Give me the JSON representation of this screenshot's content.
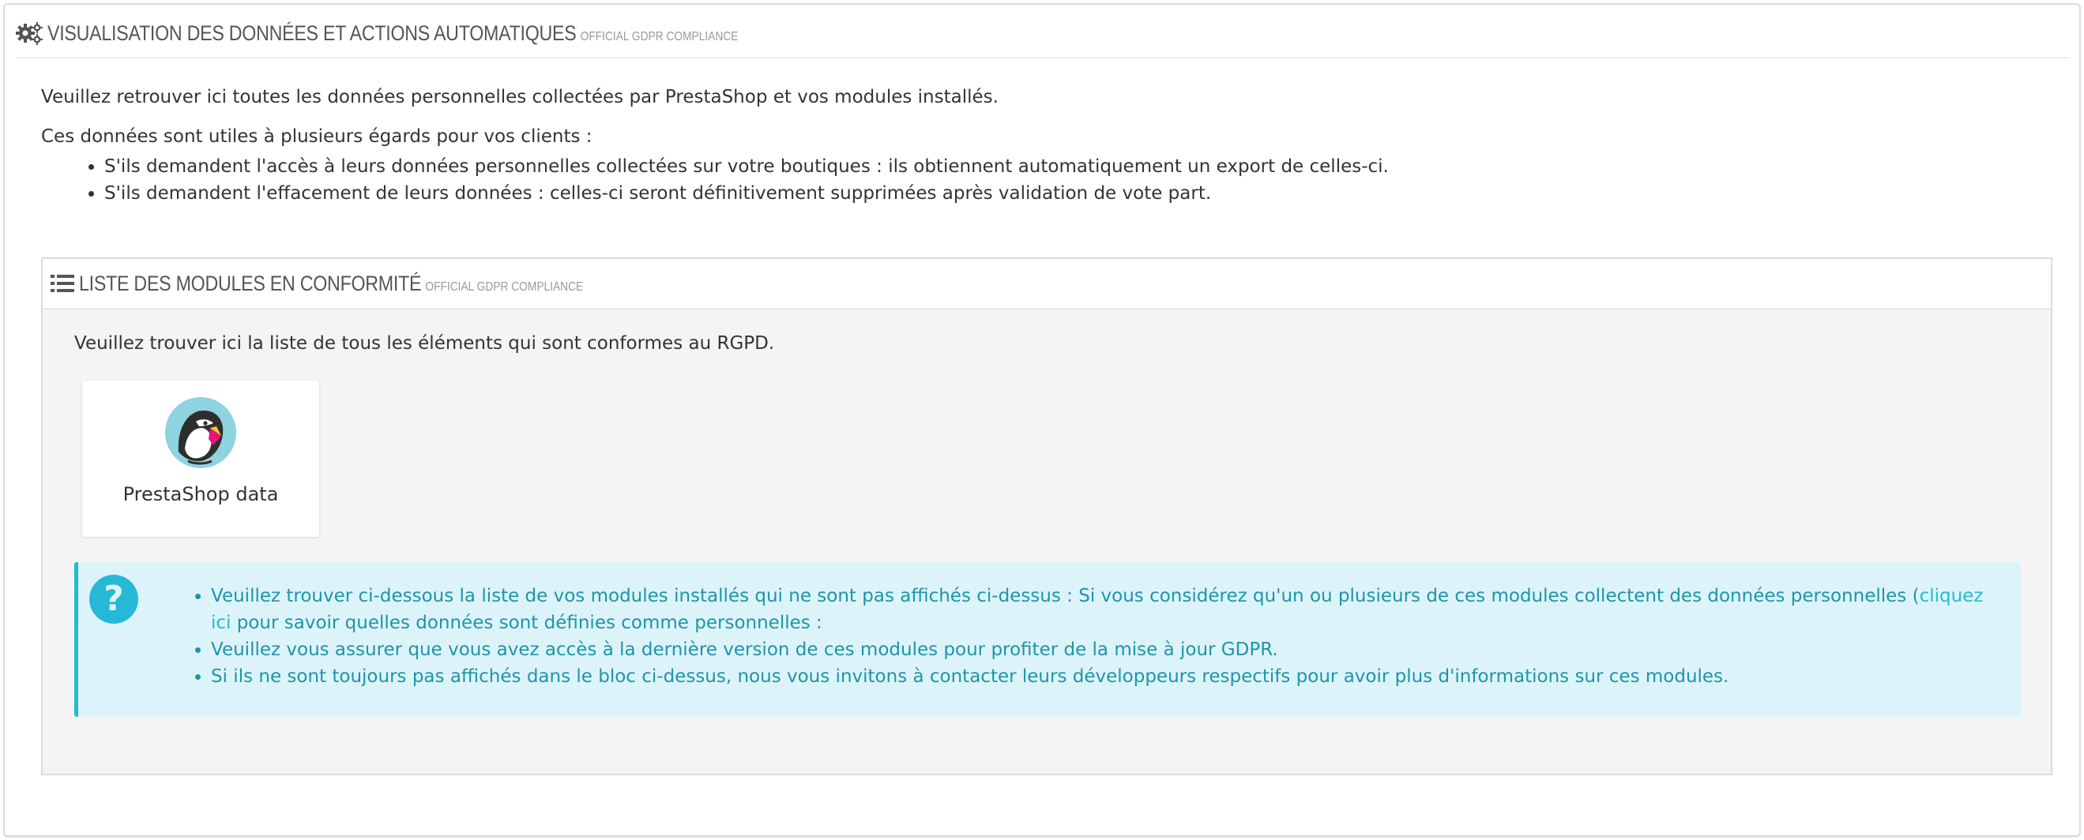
{
  "main_panel": {
    "icon": "gears-icon",
    "title": "VISUALISATION DES DONNÉES ET ACTIONS AUTOMATIQUES",
    "subtitle": "OFFICIAL GDPR COMPLIANCE",
    "intro": "Veuillez retrouver ici toutes les données personnelles collectées par PrestaShop et vos modules installés.",
    "uses_heading": "Ces données sont utiles à plusieurs égards pour vos clients :",
    "uses": [
      "S'ils demandent l'accès à leurs données personnelles collectées sur votre boutiques : ils obtiennent automatiquement un export de celles-ci.",
      "S'ils demandent l'effacement de leurs données : celles-ci seront définitivement supprimées après validation de vote part."
    ]
  },
  "modules_panel": {
    "icon": "list-icon",
    "title": "LISTE DES MODULES EN CONFORMITÉ",
    "subtitle": "OFFICIAL GDPR COMPLIANCE",
    "description": "Veuillez trouver ici la liste de tous les éléments qui sont conformes au RGPD.",
    "modules": [
      {
        "name": "PrestaShop data",
        "logo": "prestashop-puffin-logo"
      }
    ]
  },
  "info_alert": {
    "icon": "question-icon",
    "item1_text": "Veuillez trouver ci-dessous la liste de vos modules installés qui ne sont pas affichés ci-dessus : Si vous considérez qu'un ou plusieurs de ces modules collectent des données personnelles (",
    "item1_link": "cliquez ici",
    "item1_suffix": " pour savoir quelles données sont définies comme personnelles :",
    "item2": "Veuillez vous assurer que vous avez accès à la dernière version de ces modules pour profiter de la mise à jour GDPR.",
    "item3": "Si ils ne sont toujours pas affichés dans le bloc ci-dessus, nous vous invitons à contacter leurs développeurs respectifs pour avoir plus d'informations sur ces modules."
  },
  "colors": {
    "info_accent": "#25b9d7",
    "info_background": "#dcf4f9",
    "info_text": "#1e94ab",
    "panel_background": "#f4f4f4"
  }
}
